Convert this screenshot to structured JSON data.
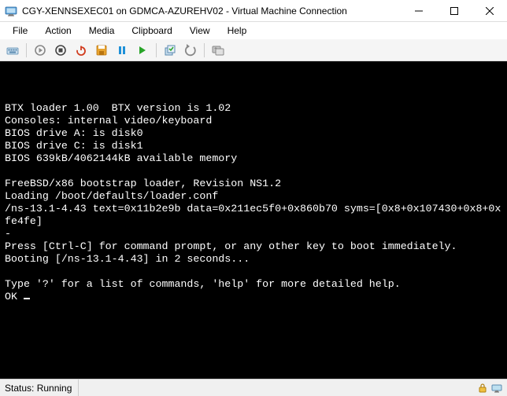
{
  "titlebar": {
    "title": "CGY-XENNSEXEC01 on GDMCA-AZUREHV02 - Virtual Machine Connection"
  },
  "menubar": {
    "items": [
      "File",
      "Action",
      "Media",
      "Clipboard",
      "View",
      "Help"
    ]
  },
  "toolbar": {
    "icons": [
      "ctrl-alt-del-icon",
      "start-icon",
      "turnoff-icon",
      "shutdown-icon",
      "save-icon",
      "pause-icon",
      "resume-icon",
      "checkpoint-icon",
      "revert-icon",
      "share-icon"
    ]
  },
  "console": {
    "lines": [
      "",
      "",
      "",
      "BTX loader 1.00  BTX version is 1.02",
      "Consoles: internal video/keyboard",
      "BIOS drive A: is disk0",
      "BIOS drive C: is disk1",
      "BIOS 639kB/4062144kB available memory",
      "",
      "FreeBSD/x86 bootstrap loader, Revision NS1.2",
      "Loading /boot/defaults/loader.conf",
      "/ns-13.1-4.43 text=0x11b2e9b data=0x211ec5f0+0x860b70 syms=[0x8+0x107430+0x8+0xfe4fe]",
      "-",
      "Press [Ctrl-C] for command prompt, or any other key to boot immediately.",
      "Booting [/ns-13.1-4.43] in 2 seconds...",
      "",
      "Type '?' for a list of commands, 'help' for more detailed help."
    ],
    "prompt": "OK "
  },
  "statusbar": {
    "text": "Status: Running"
  }
}
